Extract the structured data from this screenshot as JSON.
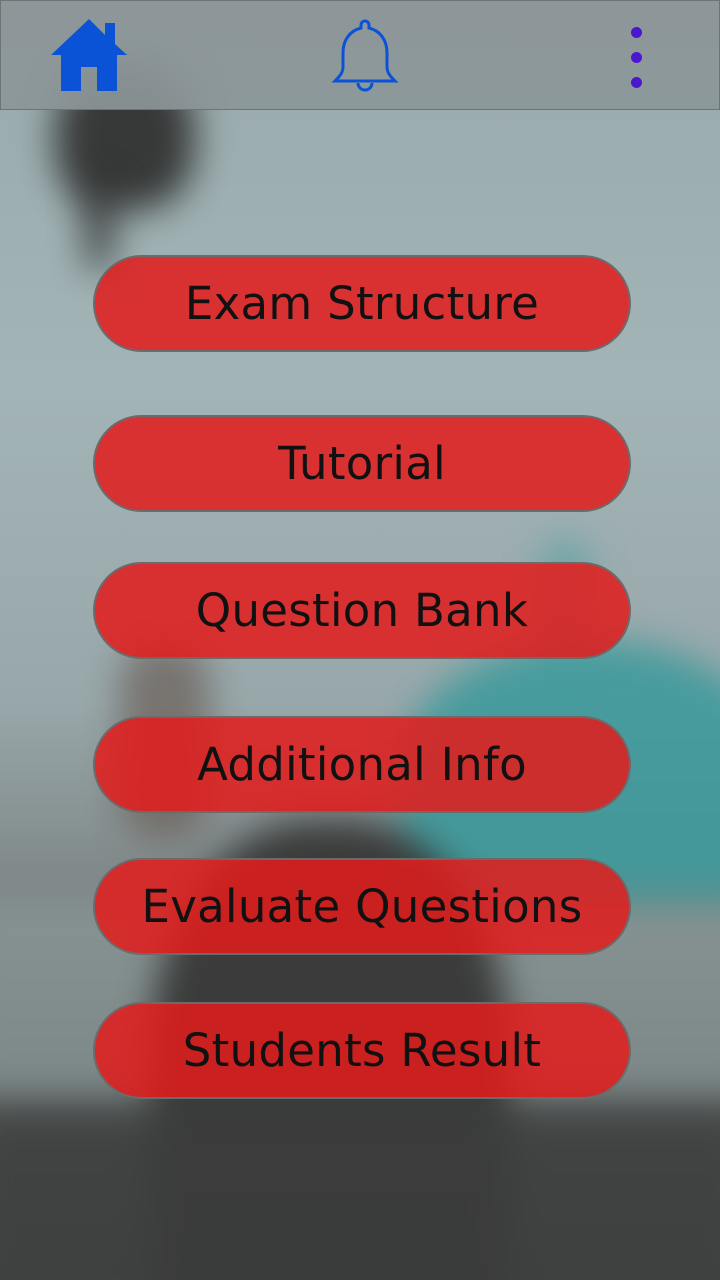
{
  "topbar": {
    "home_icon": "home-icon",
    "bell_icon": "bell-outline-icon",
    "more_icon": "more-vertical-icon",
    "home_color": "#0b53d6",
    "bell_color": "#0b53d6",
    "more_color": "#4a16cf"
  },
  "menu": {
    "items": [
      {
        "label": "Exam Structure"
      },
      {
        "label": "Tutorial"
      },
      {
        "label": "Question Bank"
      },
      {
        "label": "Additional Info"
      },
      {
        "label": "Evaluate Questions"
      },
      {
        "label": "Students Result"
      }
    ],
    "button_color": "#e21c1c"
  }
}
